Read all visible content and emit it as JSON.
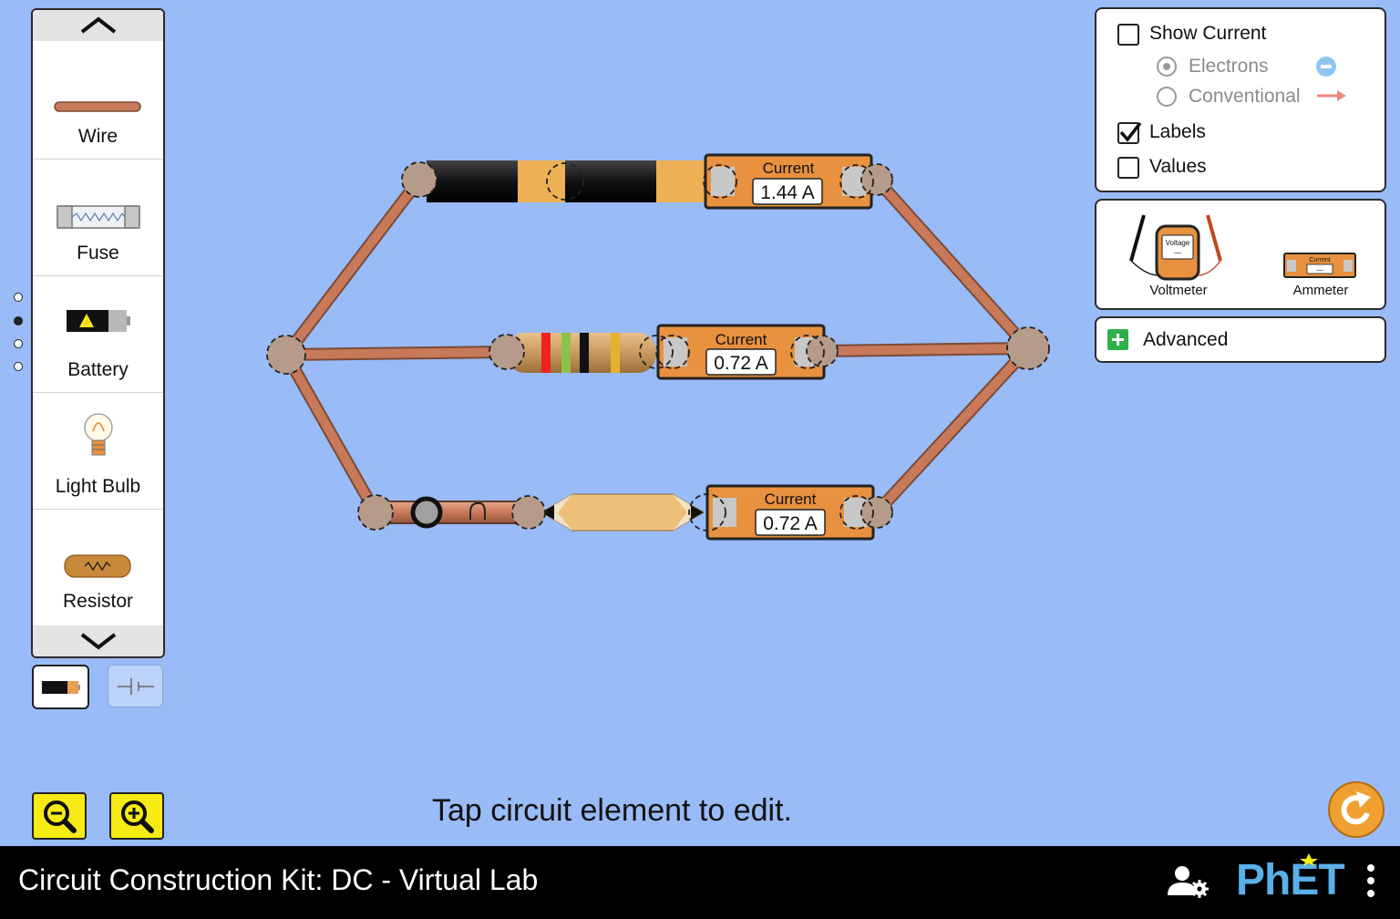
{
  "toolbox": {
    "items": [
      {
        "label": "Wire"
      },
      {
        "label": "Fuse"
      },
      {
        "label": "Battery"
      },
      {
        "label": "Light Bulb"
      },
      {
        "label": "Resistor"
      }
    ]
  },
  "display_options": {
    "show_current": "Show Current",
    "electrons": "Electrons",
    "conventional": "Conventional",
    "labels": "Labels",
    "values": "Values",
    "show_current_checked": false,
    "labels_checked": true,
    "values_checked": false,
    "selected_current_type": "Electrons"
  },
  "sensors": {
    "voltmeter": "Voltmeter",
    "ammeter": "Ammeter",
    "voltmeter_screen": "Voltage",
    "ammeter_screen": "Current",
    "placeholder": "—"
  },
  "advanced": {
    "label": "Advanced"
  },
  "circuit": {
    "ammeters": [
      {
        "title": "Current",
        "value": "1.44 A"
      },
      {
        "title": "Current",
        "value": "0.72 A"
      },
      {
        "title": "Current",
        "value": "0.72 A"
      }
    ]
  },
  "hint": "Tap circuit element to edit.",
  "footer": {
    "title": "Circuit Construction Kit: DC - Virtual Lab",
    "brand": "PhET"
  },
  "colors": {
    "background": "#99BBF7",
    "wire": "#C8795A",
    "ammeter": "#E8913F",
    "zoom_button": "#F6EB14",
    "reset": "#F0A030",
    "phet_blue": "#5AB0E8"
  }
}
